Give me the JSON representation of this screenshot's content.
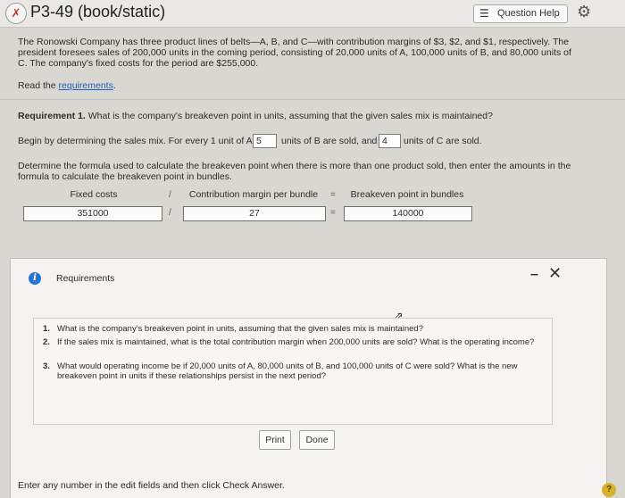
{
  "header": {
    "title": "P3-49 (book/static)",
    "question_help": "Question Help",
    "status_glyph": "✗"
  },
  "problem": {
    "intro": "The Ronowski Company has three product lines of belts—A, B, and C—with contribution margins of $3, $2, and $1, respectively. The president foresees sales of 200,000 units in the coming period, consisting of 20,000 units of A, 100,000 units of B, and 80,000 units of C. The company's fixed costs for the period are $255,000.",
    "read_prefix": "Read the ",
    "read_link": "requirements",
    "read_suffix": "."
  },
  "requirement1": {
    "label": "Requirement 1.",
    "question": " What is the company's breakeven point in units, assuming that the given sales mix is maintained?",
    "mix_part1": "Begin by determining the sales mix. For every 1 unit of A,",
    "mix_value_b": "5",
    "mix_part2": "units of B are sold, and",
    "mix_value_c": "4",
    "mix_part3": "units of C are sold.",
    "formula_intro": "Determine the formula used to calculate the breakeven point when there is more than one product sold, then enter the amounts in the formula to calculate the breakeven point in bundles.",
    "formula": {
      "h1": "Fixed costs",
      "op1": "/",
      "h2": "Contribution margin per bundle",
      "op2": "=",
      "h3": "Breakeven point in bundles",
      "v1": "351000",
      "v2": "27",
      "v3": "140000"
    }
  },
  "requirements_panel": {
    "title": "Requirements",
    "items": [
      {
        "num": "1.",
        "text": "What is the company's breakeven point in units, assuming that the given sales mix is maintained?"
      },
      {
        "num": "2.",
        "text": "If the sales mix is maintained, what is the total contribution margin when 200,000 units are sold? What is the operating income?"
      },
      {
        "num": "3.",
        "text": "What would operating income be if 20,000 units of A, 80,000 units of B, and 100,000 units of C were sold? What is the new breakeven point in units if these relationships persist in the next period?"
      }
    ],
    "print": "Print",
    "done": "Done"
  },
  "footer": {
    "instruction": "Enter any number in the edit fields and then click Check Answer."
  },
  "colors": {
    "link": "#1b5fbf",
    "info_icon": "#2677d2",
    "help_dot": "#d7b12a"
  }
}
